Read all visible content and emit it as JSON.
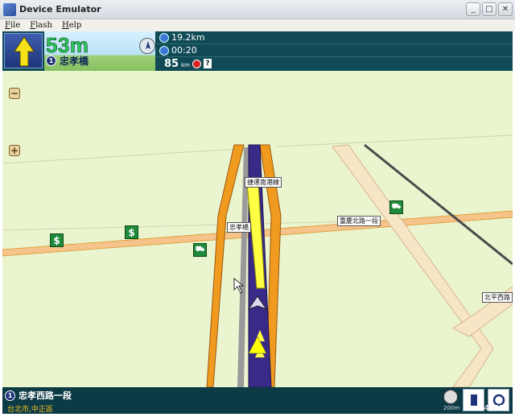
{
  "window": {
    "title": "Device Emulator",
    "min": "_",
    "max": "□",
    "close": "✕"
  },
  "menu": [
    "File",
    "Flash",
    "Help"
  ],
  "nav": {
    "distance": "53m",
    "next_road_shield": "1",
    "next_road": "忠孝橋",
    "remaining_distance": "19.2km",
    "eta": "00:20",
    "speed": "85",
    "speed_unit": "km",
    "help_label": "?"
  },
  "map": {
    "zoom_out": "−",
    "zoom_in": "+",
    "labels": {
      "mrt_line": "捷運南港線",
      "zhongxiao_bridge": "忠孝橋",
      "chongqing_n_rd": "重慶北路一段",
      "beiping_w_rd": "北平西路"
    },
    "poi_symbol": "$"
  },
  "bottom": {
    "shield": "1",
    "current_street": "忠孝西路一段",
    "district": "台北市,中正區",
    "scale": "200m",
    "build_id": "#47277"
  },
  "colors": {
    "route": "#ffff00",
    "road_primary": "#f4a12c",
    "map_bg": "#eaf5cf"
  }
}
